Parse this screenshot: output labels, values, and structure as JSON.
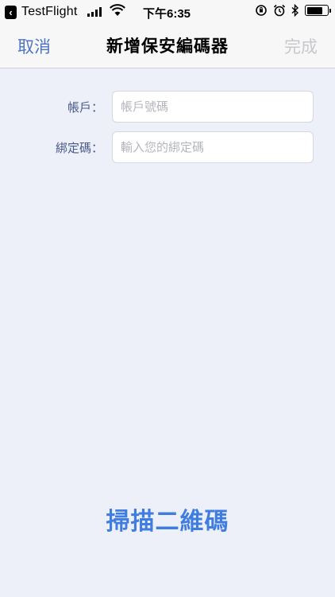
{
  "status_bar": {
    "back_app_label": "TestFlight",
    "time": "下午6:35"
  },
  "nav": {
    "cancel_label": "取消",
    "title": "新增保安編碼器",
    "done_label": "完成"
  },
  "form": {
    "account": {
      "label": "帳戶：",
      "placeholder": "帳戶號碼",
      "value": ""
    },
    "binding_code": {
      "label": "綁定碼：",
      "placeholder": "輸入您的綁定碼",
      "value": ""
    }
  },
  "scan_button_label": "掃描二維碼",
  "colors": {
    "accent": "#4e74c4",
    "scan": "#3f7ee0",
    "disabled": "#c8c8cc",
    "background": "#edeff9"
  }
}
